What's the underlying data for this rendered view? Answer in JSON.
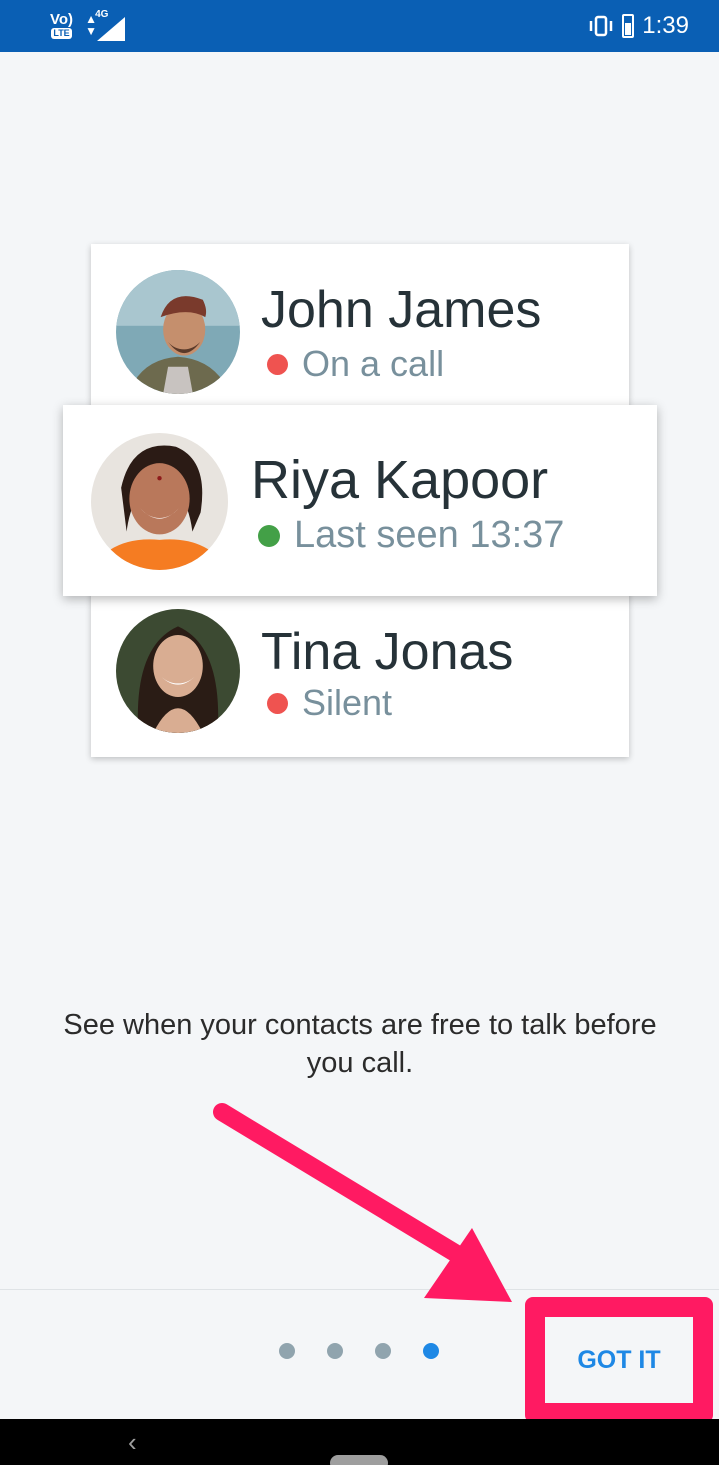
{
  "status_bar": {
    "volte_top": "Vo)",
    "volte_bottom": "LTE",
    "network": "4G",
    "time": "1:39",
    "background": "#0a5fb4"
  },
  "contacts": [
    {
      "name": "John James",
      "status": "On a call",
      "status_color": "#ef5350",
      "avatar": "john-avatar"
    },
    {
      "name": "Riya Kapoor",
      "status": "Last seen 13:37",
      "status_color": "#43a047",
      "avatar": "riya-avatar"
    },
    {
      "name": "Tina Jonas",
      "status": "Silent",
      "status_color": "#ef5350",
      "avatar": "tina-avatar"
    }
  ],
  "caption": "See when your contacts are free to talk before you call.",
  "pager": {
    "total": 4,
    "active": 4
  },
  "got_it_label": "GOT IT",
  "colors": {
    "accent": "#1e88e5",
    "highlight": "#ff1a62",
    "background": "#f4f6f8"
  }
}
